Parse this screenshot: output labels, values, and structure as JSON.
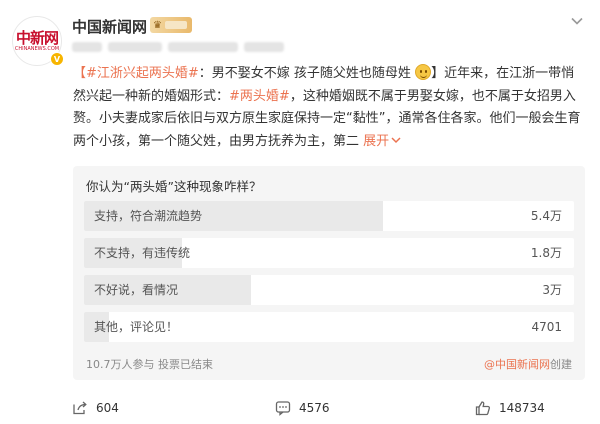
{
  "header": {
    "account_name": "中国新闻网",
    "avatar_logo": "中新网",
    "avatar_sub": "CHINANEWS.COM",
    "verified_mark": "V"
  },
  "post": {
    "tag1": "【#江浙兴起两头婚#",
    "text1": "：男不娶女不嫁 孩子随父姓也随母姓",
    "text2": "】近年来，在江浙一带悄然兴起一种新的婚姻形式：",
    "tag2": "#两头婚#",
    "text3": "，这种婚姻既不属于男娶女嫁，也不属于女招男入赘。小夫妻成家后依旧与双方原生家庭保持一定“黏性”，通常各住各家。他们一般会生育两个小孩，第一个随父姓，由男方抚养为主，第二",
    "expand": "展开",
    "expand_icon": "chevron-down-icon"
  },
  "poll": {
    "question": "你认为“两头婚”这种现象咋样？",
    "options": [
      {
        "label": "支持，符合潮流趋势",
        "count": "5.4万",
        "share": 0.61
      },
      {
        "label": "不支持，有违传统",
        "count": "1.8万",
        "share": 0.2
      },
      {
        "label": "不好说，看情况",
        "count": "3万",
        "share": 0.34
      },
      {
        "label": "其他，评论见！",
        "count": "4701",
        "share": 0.05
      }
    ],
    "footer": "10.7万人参与 投票已结束",
    "source_at": "@中国新闻网",
    "source_suffix": "创建"
  },
  "actions": {
    "repost": "604",
    "comment": "4576",
    "like": "148734"
  },
  "colors": {
    "accent": "#eb7350",
    "poll_bg": "#f5f5f5",
    "bar_fill": "#e9e9e9",
    "badge_gold": "#e9b96b"
  }
}
